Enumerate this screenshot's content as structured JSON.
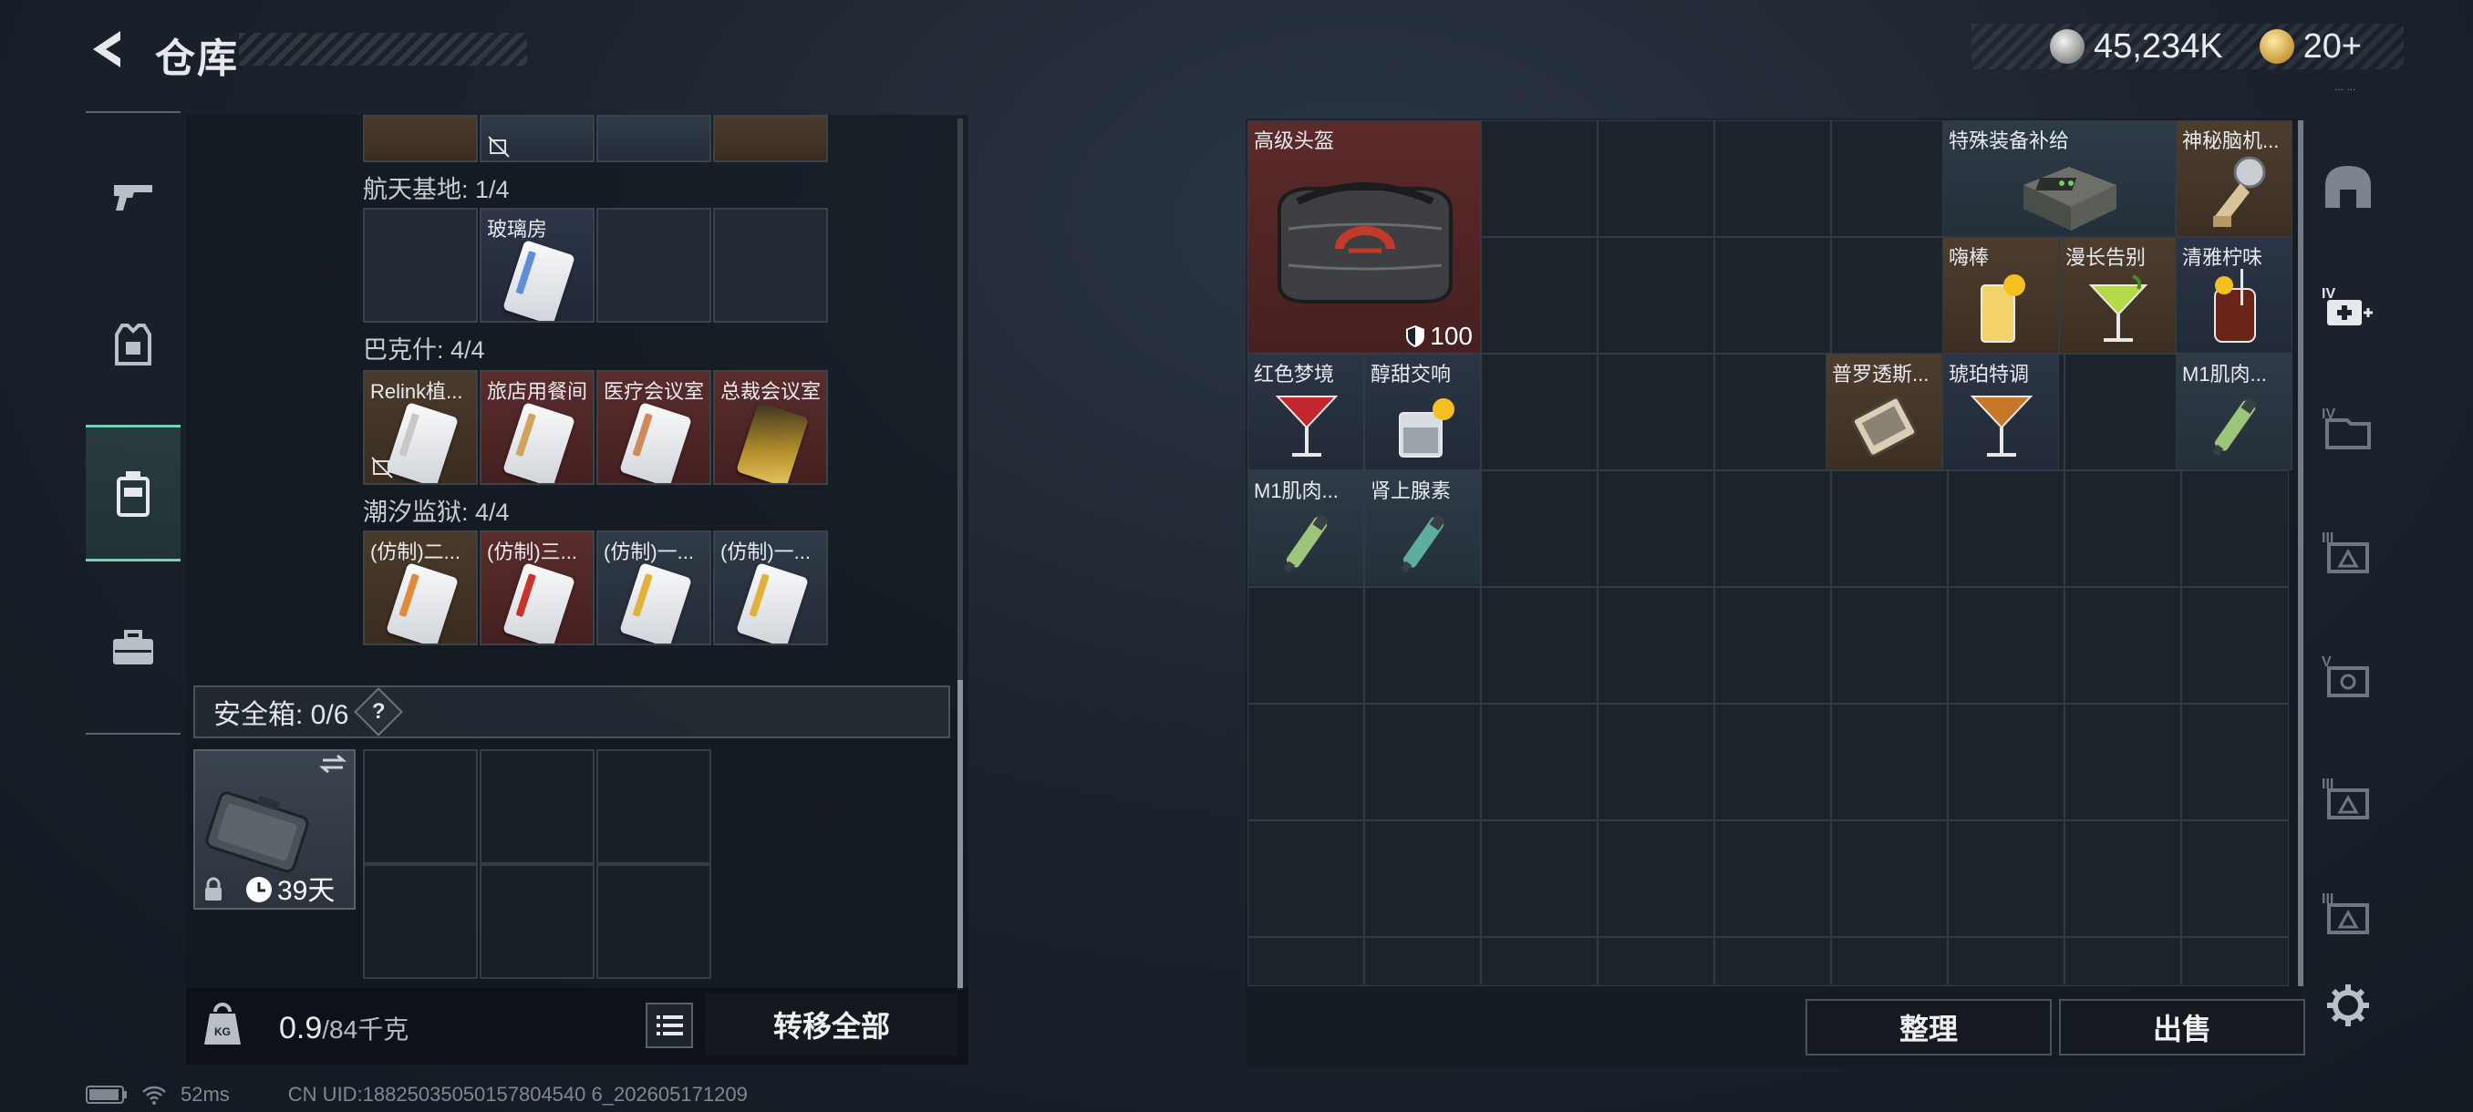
{
  "header": {
    "title": "仓库",
    "currency": [
      {
        "icon": "silver-coin-icon",
        "value": "45,234K"
      },
      {
        "icon": "gold-coin-icon",
        "value": "20+"
      }
    ],
    "version_text": "... ..."
  },
  "left_nav": [
    {
      "icon": "gun-icon",
      "active": false
    },
    {
      "icon": "armor-vest-icon",
      "active": false
    },
    {
      "icon": "backpack-icon",
      "active": true
    },
    {
      "icon": "toolbox-icon",
      "active": false
    }
  ],
  "stash": {
    "sections": [
      {
        "label": "航天基地: 1/4",
        "slots": [
          {
            "label": "",
            "color": "gray"
          },
          {
            "label": "玻璃房",
            "color": "navy"
          },
          {
            "label": "",
            "color": "gray"
          },
          {
            "label": "",
            "color": "gray"
          }
        ]
      },
      {
        "label": "巴克什: 4/4",
        "slots": [
          {
            "label": "Relink植...",
            "color": "brown"
          },
          {
            "label": "旅店用餐间",
            "color": "red"
          },
          {
            "label": "医疗会议室",
            "color": "red"
          },
          {
            "label": "总裁会议室",
            "color": "red"
          }
        ]
      },
      {
        "label": "潮汐监狱: 4/4",
        "slots": [
          {
            "label": "(仿制)二...",
            "color": "brown"
          },
          {
            "label": "(仿制)三...",
            "color": "red"
          },
          {
            "label": "(仿制)一...",
            "color": "slate"
          },
          {
            "label": "(仿制)一...",
            "color": "slate"
          }
        ]
      }
    ],
    "safe_box": {
      "label": "安全箱: 0/6",
      "help": "?",
      "days": "39天"
    }
  },
  "bottom_bar": {
    "weight_current": "0.9",
    "weight_max": "/84千克",
    "weight_icon_text": "KG",
    "transfer_all": "转移全部"
  },
  "inventory": {
    "items": [
      {
        "label": "高级头盔",
        "color": "red",
        "durability": "100"
      },
      {
        "label": "特殊装备补给",
        "color": "slate"
      },
      {
        "label": "神秘脑机...",
        "color": "brown"
      },
      {
        "label": "嗨棒",
        "color": "brown"
      },
      {
        "label": "漫长告别",
        "color": "brown"
      },
      {
        "label": "清雅柠味",
        "color": "navy"
      },
      {
        "label": "红色梦境",
        "color": "navy"
      },
      {
        "label": "醇甜交响",
        "color": "navy"
      },
      {
        "label": "普罗透斯...",
        "color": "brown"
      },
      {
        "label": "琥珀特调",
        "color": "navy"
      },
      {
        "label": "M1肌肉...",
        "color": "slate"
      },
      {
        "label": "M1肌肉...",
        "color": "slate"
      },
      {
        "label": "肾上腺素",
        "color": "slate"
      }
    ],
    "sort_button": "整理",
    "sell_button": "出售"
  },
  "status_bar": {
    "ping": "52ms",
    "uid": "CN UID:18825035050157804540 6_202605171209"
  },
  "colors": {
    "accent": "#6fd3b8",
    "slot_red": "#5a2c2c",
    "slot_brown": "#4a3a2c",
    "slot_navy": "#2c3648"
  }
}
